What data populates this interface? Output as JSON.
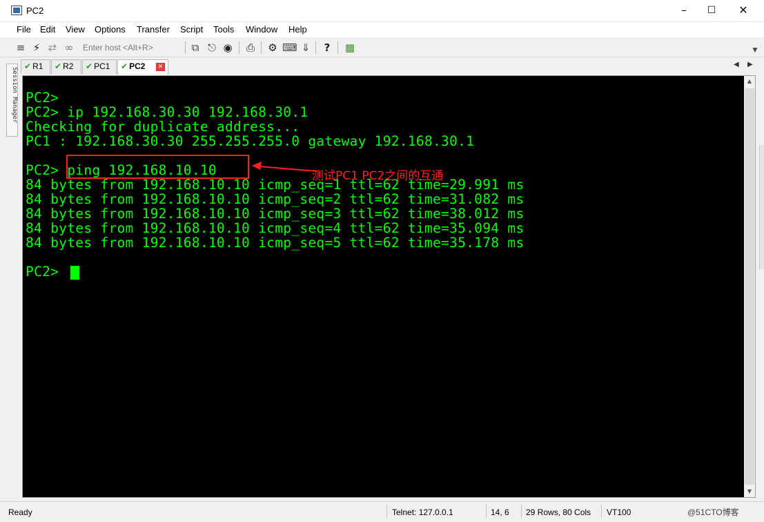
{
  "window": {
    "title": "PC2"
  },
  "menu": [
    "File",
    "Edit",
    "View",
    "Options",
    "Transfer",
    "Script",
    "Tools",
    "Window",
    "Help"
  ],
  "toolbar": {
    "host_placeholder": "Enter host <Alt+R>"
  },
  "sidebar": {
    "session_manager_label": "Session Manager"
  },
  "tabs": [
    {
      "label": "R1",
      "active": false
    },
    {
      "label": "R2",
      "active": false
    },
    {
      "label": "PC1",
      "active": false
    },
    {
      "label": "PC2",
      "active": true
    }
  ],
  "terminal": {
    "lines": [
      "PC2>",
      "PC2> ip 192.168.30.30 192.168.30.1",
      "Checking for duplicate address...",
      "PC1 : 192.168.30.30 255.255.255.0 gateway 192.168.30.1",
      "",
      "PC2> ping 192.168.10.10",
      "84 bytes from 192.168.10.10 icmp_seq=1 ttl=62 time=29.991 ms",
      "84 bytes from 192.168.10.10 icmp_seq=2 ttl=62 time=31.082 ms",
      "84 bytes from 192.168.10.10 icmp_seq=3 ttl=62 time=38.012 ms",
      "84 bytes from 192.168.10.10 icmp_seq=4 ttl=62 time=35.094 ms",
      "84 bytes from 192.168.10.10 icmp_seq=5 ttl=62 time=35.178 ms",
      "",
      "PC2> "
    ],
    "text_color": "#00ff00",
    "background": "#000000"
  },
  "annotation": {
    "text": "测试PC1 PC2之间的互通",
    "color": "#ff2020"
  },
  "status": {
    "ready": "Ready",
    "connection": "Telnet: 127.0.0.1",
    "position": "14,  6",
    "size": "29 Rows, 80 Cols",
    "emulation": "VT100",
    "watermark": "@51CTO博客"
  }
}
